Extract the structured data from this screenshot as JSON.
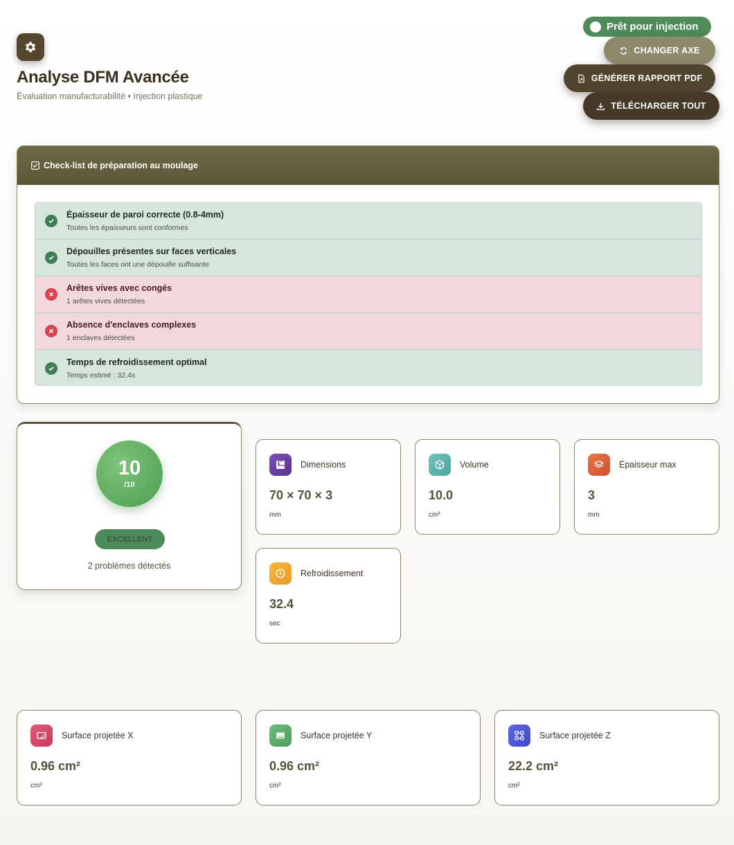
{
  "header": {
    "title": "Analyse DFM Avancée",
    "subtitle": "Évaluation manufacturabilité • Injection plastique",
    "status": "Prêt pour injection",
    "buttons": {
      "change_axis": "CHANGER AXE",
      "generate_pdf": "GÉNÉRER RAPPORT PDF",
      "download_all": "TÉLÉCHARGER TOUT"
    }
  },
  "checklist": {
    "title": "Check-list de préparation au moulage",
    "items": [
      {
        "status": "ok",
        "title": "Épaisseur de paroi correcte (0.8-4mm)",
        "detail": "Toutes les épaisseurs sont conformes"
      },
      {
        "status": "ok",
        "title": "Dépouilles présentes sur faces verticales",
        "detail": "Toutes les faces ont une dépouille suffisante"
      },
      {
        "status": "ko",
        "title": "Arêtes vives avec congés",
        "detail": "1 arêtes vives détectées"
      },
      {
        "status": "ko",
        "title": "Absence d'enclaves complexes",
        "detail": "1 enclaves détectées"
      },
      {
        "status": "ok",
        "title": "Temps de refroidissement optimal",
        "detail": "Temps estimé : 32.4s"
      }
    ]
  },
  "score": {
    "value": "10",
    "max": "/10",
    "rating": "EXCELLENT",
    "issues": "2 problèmes détectés"
  },
  "metrics": {
    "dimensions": {
      "label": "Dimensions",
      "value": "70 × 70 × 3",
      "unit": "mm",
      "icon": "ruler-icon",
      "color": "#6a3fa0"
    },
    "volume": {
      "label": "Volume",
      "value": "10.0",
      "unit": "cm³",
      "icon": "cube-icon",
      "color": "#5fb3ad"
    },
    "thickness": {
      "label": "Épaisseur max",
      "value": "3",
      "unit": "mm",
      "icon": "layers-icon",
      "color": "#e0623a"
    },
    "cooling": {
      "label": "Refroidissement",
      "value": "32.4",
      "unit": "sec",
      "icon": "clock-icon",
      "color": "#f0a830"
    }
  },
  "surfaces": {
    "x": {
      "label": "Surface projetée X",
      "value": "0.96 cm²",
      "unit": "cm²",
      "icon": "surface-x-icon",
      "color": "#d8456a"
    },
    "y": {
      "label": "Surface projetée Y",
      "value": "0.96 cm²",
      "unit": "cm²",
      "icon": "surface-y-icon",
      "color": "#5aac6a"
    },
    "z": {
      "label": "Surface projetée Z",
      "value": "22.2 cm²",
      "unit": "cm²",
      "icon": "surface-z-icon",
      "color": "#4f5ad8"
    }
  }
}
